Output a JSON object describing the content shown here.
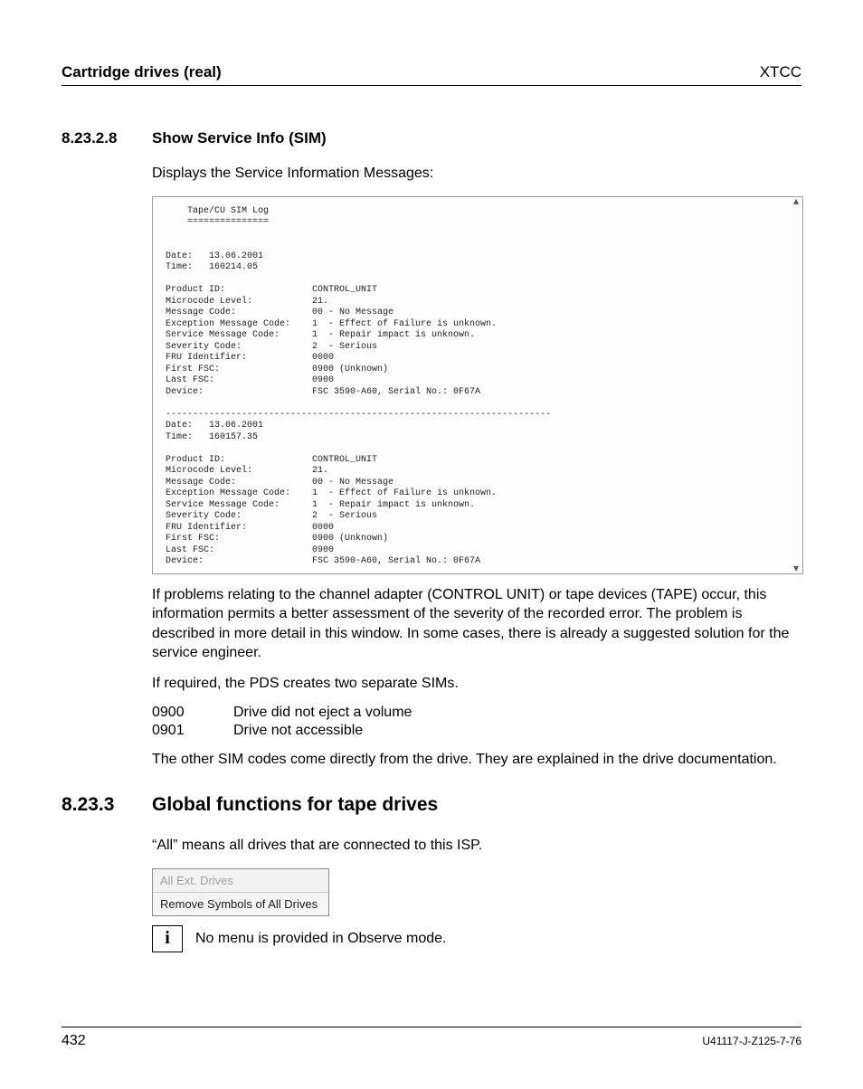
{
  "header": {
    "left": "Cartridge drives (real)",
    "right": "XTCC"
  },
  "section1": {
    "num": "8.23.2.8",
    "title": "Show Service Info (SIM)",
    "intro": "Displays the Service Information Messages:"
  },
  "sim_log": "    Tape/CU SIM Log\n    ===============\n\n\nDate:   13.06.2001\nTime:   160214.05\n\nProduct ID:                CONTROL_UNIT\nMicrocode Level:           21.\nMessage Code:              00 - No Message\nException Message Code:    1  - Effect of Failure is unknown.\nService Message Code:      1  - Repair impact is unknown.\nSeverity Code:             2  - Serious\nFRU Identifier:            0000\nFirst FSC:                 0900 (Unknown)\nLast FSC:                  0900\nDevice:                    FSC 3590-A60, Serial No.: 0F67A\n\n-----------------------------------------------------------------------\nDate:   13.06.2001\nTime:   160157.35\n\nProduct ID:                CONTROL_UNIT\nMicrocode Level:           21.\nMessage Code:              00 - No Message\nException Message Code:    1  - Effect of Failure is unknown.\nService Message Code:      1  - Repair impact is unknown.\nSeverity Code:             2  - Serious\nFRU Identifier:            0000\nFirst FSC:                 0900 (Unknown)\nLast FSC:                  0900\nDevice:                    FSC 3590-A60, Serial No.: 0F67A",
  "para1": "If problems relating to the channel adapter (CONTROL UNIT) or tape devices (TAPE) occur, this information permits a better assessment of the severity of the recorded error. The problem is described in more detail in this window. In some cases, there is already a suggested solution for the service engineer.",
  "para2": "If required, the PDS creates two separate SIMs.",
  "codes": [
    {
      "code": "0900",
      "desc": "Drive did not eject a volume"
    },
    {
      "code": "0901",
      "desc": "Drive not accessible"
    }
  ],
  "para3": "The other SIM codes come directly from the drive. They are explained in the drive documentation.",
  "section2": {
    "num": "8.23.3",
    "title": "Global functions for tape drives",
    "intro": "“All” means all drives that are connected to this ISP."
  },
  "menu": {
    "title": "All Ext. Drives",
    "item": "Remove Symbols of All Drives"
  },
  "note": {
    "icon": "i",
    "text": "No menu is provided in Observe mode."
  },
  "footer": {
    "page": "432",
    "docid": "U41117-J-Z125-7-76"
  }
}
